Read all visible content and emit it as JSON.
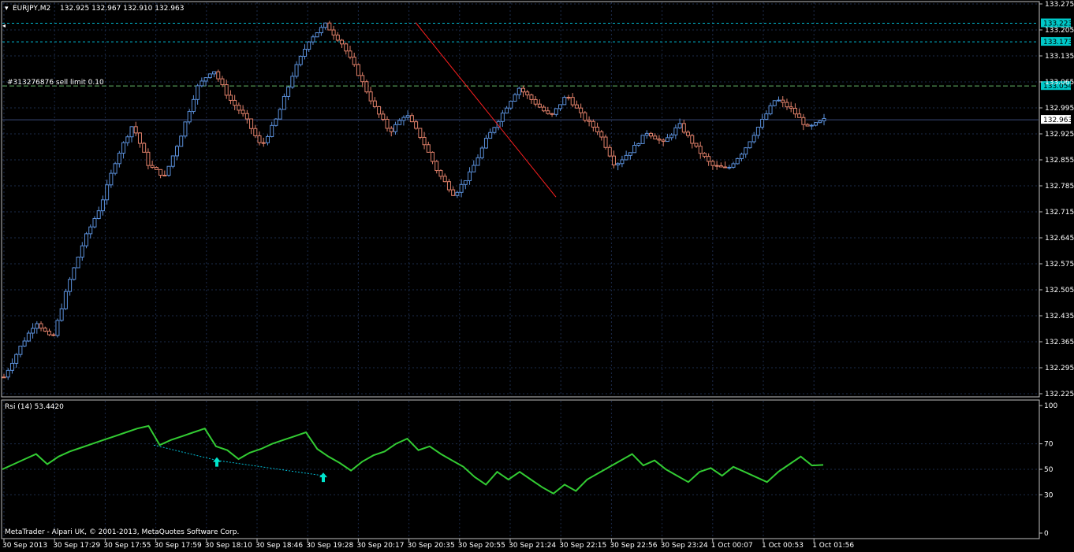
{
  "colors": {
    "background": "#000000",
    "grid": "#1c2b4a",
    "frame": "#c0c0c0",
    "bull": "#5a8fd9",
    "bear": "#e0806a",
    "rsi": "#33cc33",
    "level_line": "#00bcd4",
    "order_line": "#66bb6a",
    "trendline": "#ff2020",
    "arrow": "#00e5cc",
    "text": "#ffffff"
  },
  "header": {
    "symbol_tf": "EURJPY,M2",
    "ohlc": "132.925 132.967 132.910 132.963"
  },
  "order_label": "#313276876 sell limit 0.10",
  "footer": "MetaTrader - Alpari UK, © 2001-2013, MetaQuotes Software Corp.",
  "chart_data": [
    {
      "type": "candlestick",
      "symbol": "EURJPY",
      "timeframe": "M2",
      "y_ticks": [
        "133.275",
        "133.205",
        "133.135",
        "133.065",
        "132.995",
        "132.925",
        "132.855",
        "132.785",
        "132.715",
        "132.645",
        "132.575",
        "132.505",
        "132.435",
        "132.365",
        "132.295",
        "132.225"
      ],
      "y_tick_values": [
        133.275,
        133.205,
        133.135,
        133.065,
        132.995,
        132.925,
        132.855,
        132.785,
        132.715,
        132.645,
        132.575,
        132.505,
        132.435,
        132.365,
        132.295,
        132.225
      ],
      "ylim": [
        132.225,
        133.275
      ],
      "x_ticks": [
        "30 Sep 2013",
        "30 Sep 17:29",
        "30 Sep 17:55",
        "30 Sep 17:59",
        "30 Sep 18:10",
        "30 Sep 18:46",
        "30 Sep 19:28",
        "30 Sep 20:17",
        "30 Sep 20:35",
        "30 Sep 20:55",
        "30 Sep 21:24",
        "30 Sep 22:15",
        "30 Sep 22:56",
        "30 Sep 23:24",
        "1 Oct 00:07",
        "1 Oct 00:53",
        "1 Oct 01:56"
      ],
      "price_levels": [
        {
          "label": "133.223",
          "value": 133.223,
          "style": "dashed"
        },
        {
          "label": "133.173",
          "value": 133.173,
          "style": "dashed"
        },
        {
          "label": "133.054",
          "value": 133.054,
          "style": "order"
        },
        {
          "label": "132.963",
          "value": 132.963,
          "style": "current"
        }
      ],
      "path": [
        132.27,
        132.35,
        132.42,
        132.37,
        132.52,
        132.64,
        132.73,
        132.86,
        132.95,
        132.84,
        132.81,
        132.92,
        133.05,
        133.1,
        133.02,
        132.97,
        132.89,
        132.97,
        133.09,
        133.18,
        133.22,
        133.17,
        133.09,
        133.0,
        132.93,
        132.98,
        132.91,
        132.82,
        132.76,
        132.82,
        132.91,
        132.98,
        133.05,
        133.01,
        132.97,
        133.03,
        132.97,
        132.93,
        132.84,
        132.88,
        132.93,
        132.9,
        132.95,
        132.89,
        132.84,
        132.83,
        132.88,
        132.95,
        133.02,
        132.99,
        132.94,
        132.963
      ],
      "trendline": [
        {
          "price": 133.225
        },
        {
          "price": 132.755
        }
      ]
    },
    {
      "type": "line",
      "indicator": "RSI",
      "header": "Rsi (14) 53.4420",
      "y_ticks": [
        "100",
        "70",
        "50",
        "30",
        "0"
      ],
      "y_tick_values": [
        100,
        70,
        50,
        30,
        0
      ],
      "ylim": [
        0,
        100
      ],
      "values": [
        50,
        54,
        58,
        62,
        54,
        60,
        64,
        67,
        70,
        73,
        76,
        79,
        82,
        84,
        69,
        73,
        76,
        79,
        82,
        68,
        65,
        58,
        63,
        66,
        70,
        73,
        76,
        79,
        66,
        60,
        55,
        49,
        56,
        61,
        64,
        70,
        74,
        65,
        68,
        62,
        57,
        52,
        44,
        38,
        48,
        42,
        48,
        42,
        36,
        31,
        38,
        33,
        42,
        47,
        52,
        57,
        62,
        53,
        57,
        50,
        45,
        40,
        48,
        51,
        45,
        52,
        48,
        44,
        40,
        48,
        54,
        60,
        53,
        53.442
      ],
      "divergence_line": [
        {
          "rsi": 69,
          "arrow": false
        },
        {
          "rsi": 57,
          "arrow": true
        },
        {
          "rsi": 45,
          "arrow": true
        }
      ]
    }
  ]
}
